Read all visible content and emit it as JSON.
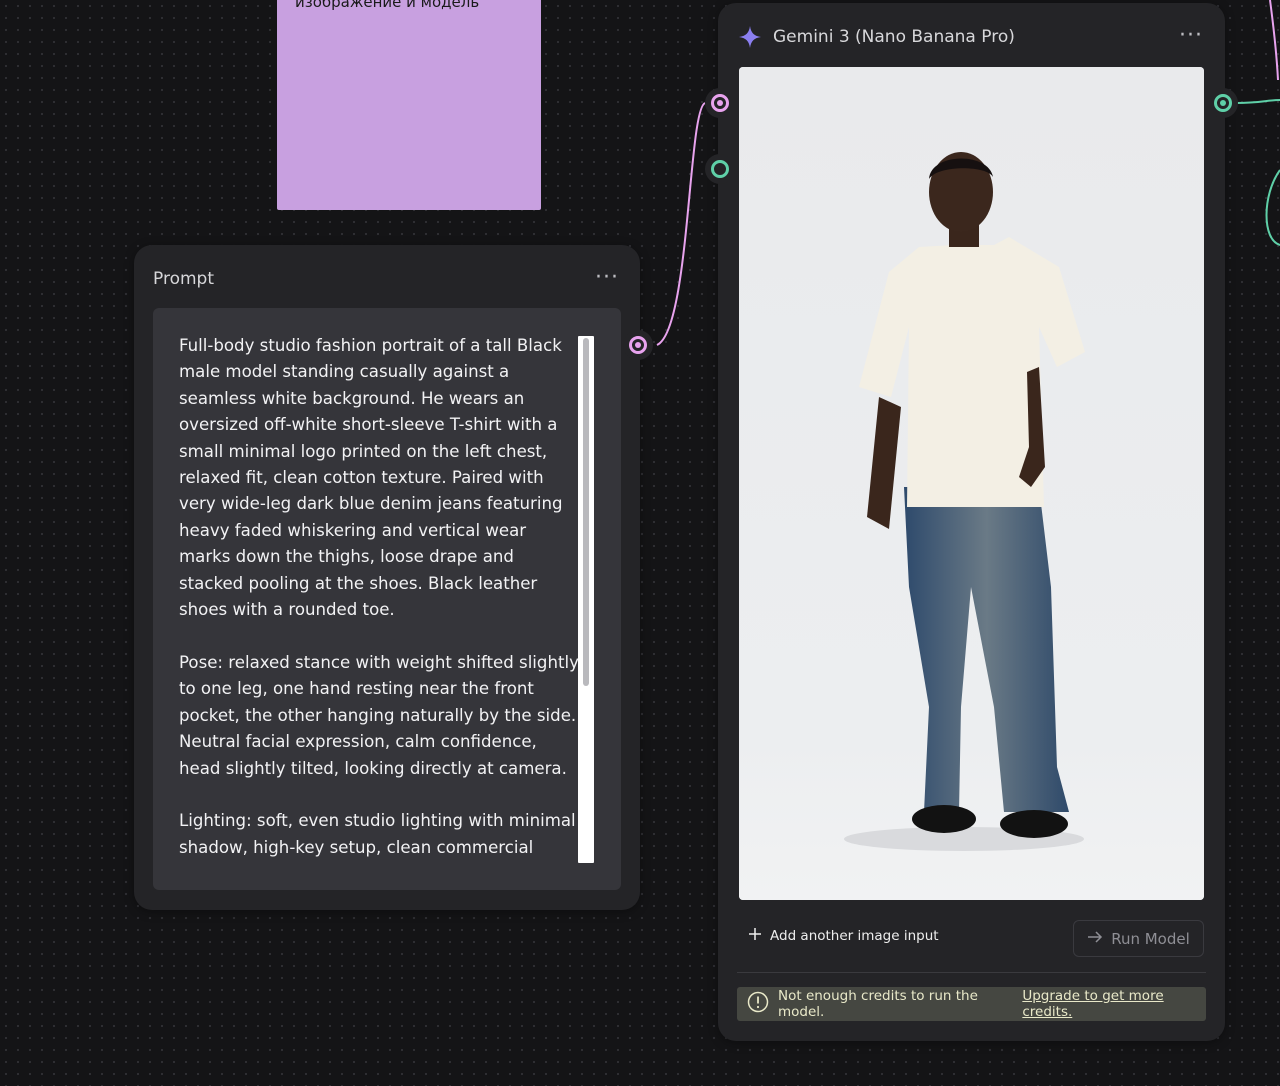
{
  "sticky_note": {
    "text": "изображение и модель"
  },
  "prompt_node": {
    "title": "Prompt",
    "menu_label": "···",
    "text": "Full-body studio fashion portrait of a tall Black male model standing casually against a seamless white background. He wears an oversized off-white short-sleeve T-shirt with a small minimal logo printed on the left chest, relaxed fit, clean cotton texture. Paired with very wide-leg dark blue denim jeans featuring heavy faded whiskering and vertical wear marks down the thighs, loose drape and stacked pooling at the shoes. Black leather shoes with a rounded toe.\n\nPose: relaxed stance with weight shifted slightly to one leg, one hand resting near the front pocket, the other hanging naturally by the side. Neutral facial expression, calm confidence, head slightly tilted, looking directly at camera.\n\nLighting: soft, even studio lighting with minimal shadow, high-key setup, clean commercial"
  },
  "gemini_node": {
    "title": "Gemini 3 (Nano Banana Pro)",
    "icon": "sparkle-icon",
    "menu_label": "···",
    "add_input_label": "Add another image input",
    "run_label": "Run Model",
    "warning_text": "Not enough credits to run the model.",
    "warning_link": "Upgrade to get more credits."
  },
  "colors": {
    "canvas": "#141416",
    "node": "#242427",
    "sticky": "#c8a0e0",
    "port_text": "#e8a3ee",
    "port_image": "#5fd0a8",
    "sparkle": "#8b7ff0",
    "warning_bg": "#454741"
  }
}
